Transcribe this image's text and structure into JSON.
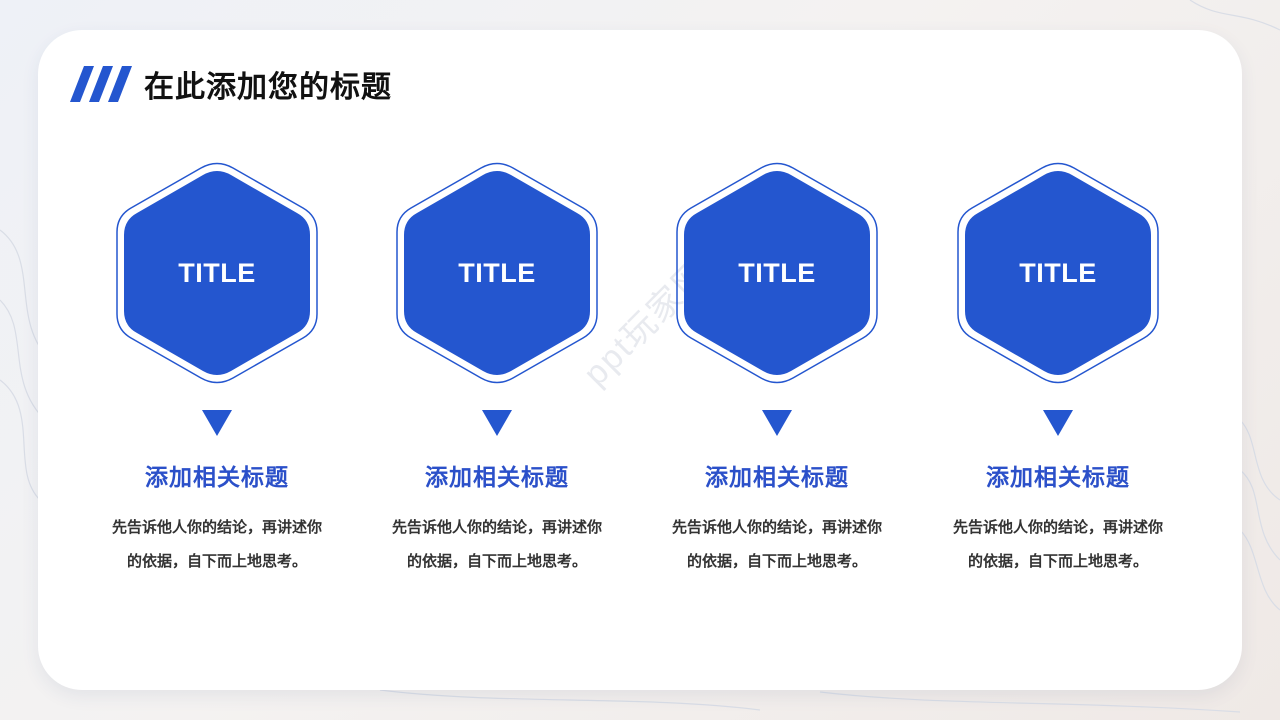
{
  "header": {
    "title": "在此添加您的标题"
  },
  "colors": {
    "accent": "#2456cf",
    "title_blue": "#2b50c9",
    "text": "#333333",
    "heading": "#111111"
  },
  "icons": {
    "header_mark": "triple-slash-stripes-icon",
    "pointer": "down-triangle-icon"
  },
  "watermark": "ppt玩家网",
  "steps": [
    {
      "hex_label": "TITLE",
      "title": "添加相关标题",
      "desc_line1": "先告诉他人你的结论，再讲述你",
      "desc_line2": "的依据，自下而上地思考。"
    },
    {
      "hex_label": "TITLE",
      "title": "添加相关标题",
      "desc_line1": "先告诉他人你的结论，再讲述你",
      "desc_line2": "的依据，自下而上地思考。"
    },
    {
      "hex_label": "TITLE",
      "title": "添加相关标题",
      "desc_line1": "先告诉他人你的结论，再讲述你",
      "desc_line2": "的依据，自下而上地思考。"
    },
    {
      "hex_label": "TITLE",
      "title": "添加相关标题",
      "desc_line1": "先告诉他人你的结论，再讲述你",
      "desc_line2": "的依据，自下而上地思考。"
    }
  ]
}
